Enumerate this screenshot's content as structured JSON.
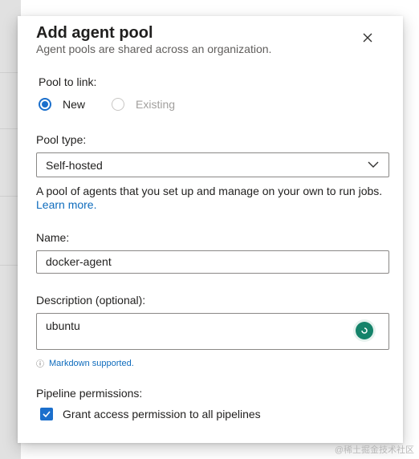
{
  "dialog": {
    "title": "Add agent pool",
    "subtitle": "Agent pools are shared across an organization."
  },
  "pool_to_link": {
    "label": "Pool to link:",
    "options": [
      {
        "label": "New",
        "selected": true,
        "enabled": true
      },
      {
        "label": "Existing",
        "selected": false,
        "enabled": false
      }
    ]
  },
  "pool_type": {
    "label": "Pool type:",
    "value": "Self-hosted",
    "help_text": "A pool of agents that you set up and manage on your own to run jobs.",
    "learn_more": "Learn more."
  },
  "name": {
    "label": "Name:",
    "value": "docker-agent"
  },
  "description": {
    "label": "Description (optional):",
    "value": "ubuntu",
    "markdown_note": "Markdown supported."
  },
  "permissions": {
    "label": "Pipeline permissions:",
    "checkbox_label": "Grant access permission to all pipelines",
    "checked": true
  },
  "watermark": "@稀土掘金技术社区",
  "colors": {
    "accent": "#1b6fcc",
    "link": "#0f6cbd",
    "grammarly": "#15836a"
  }
}
